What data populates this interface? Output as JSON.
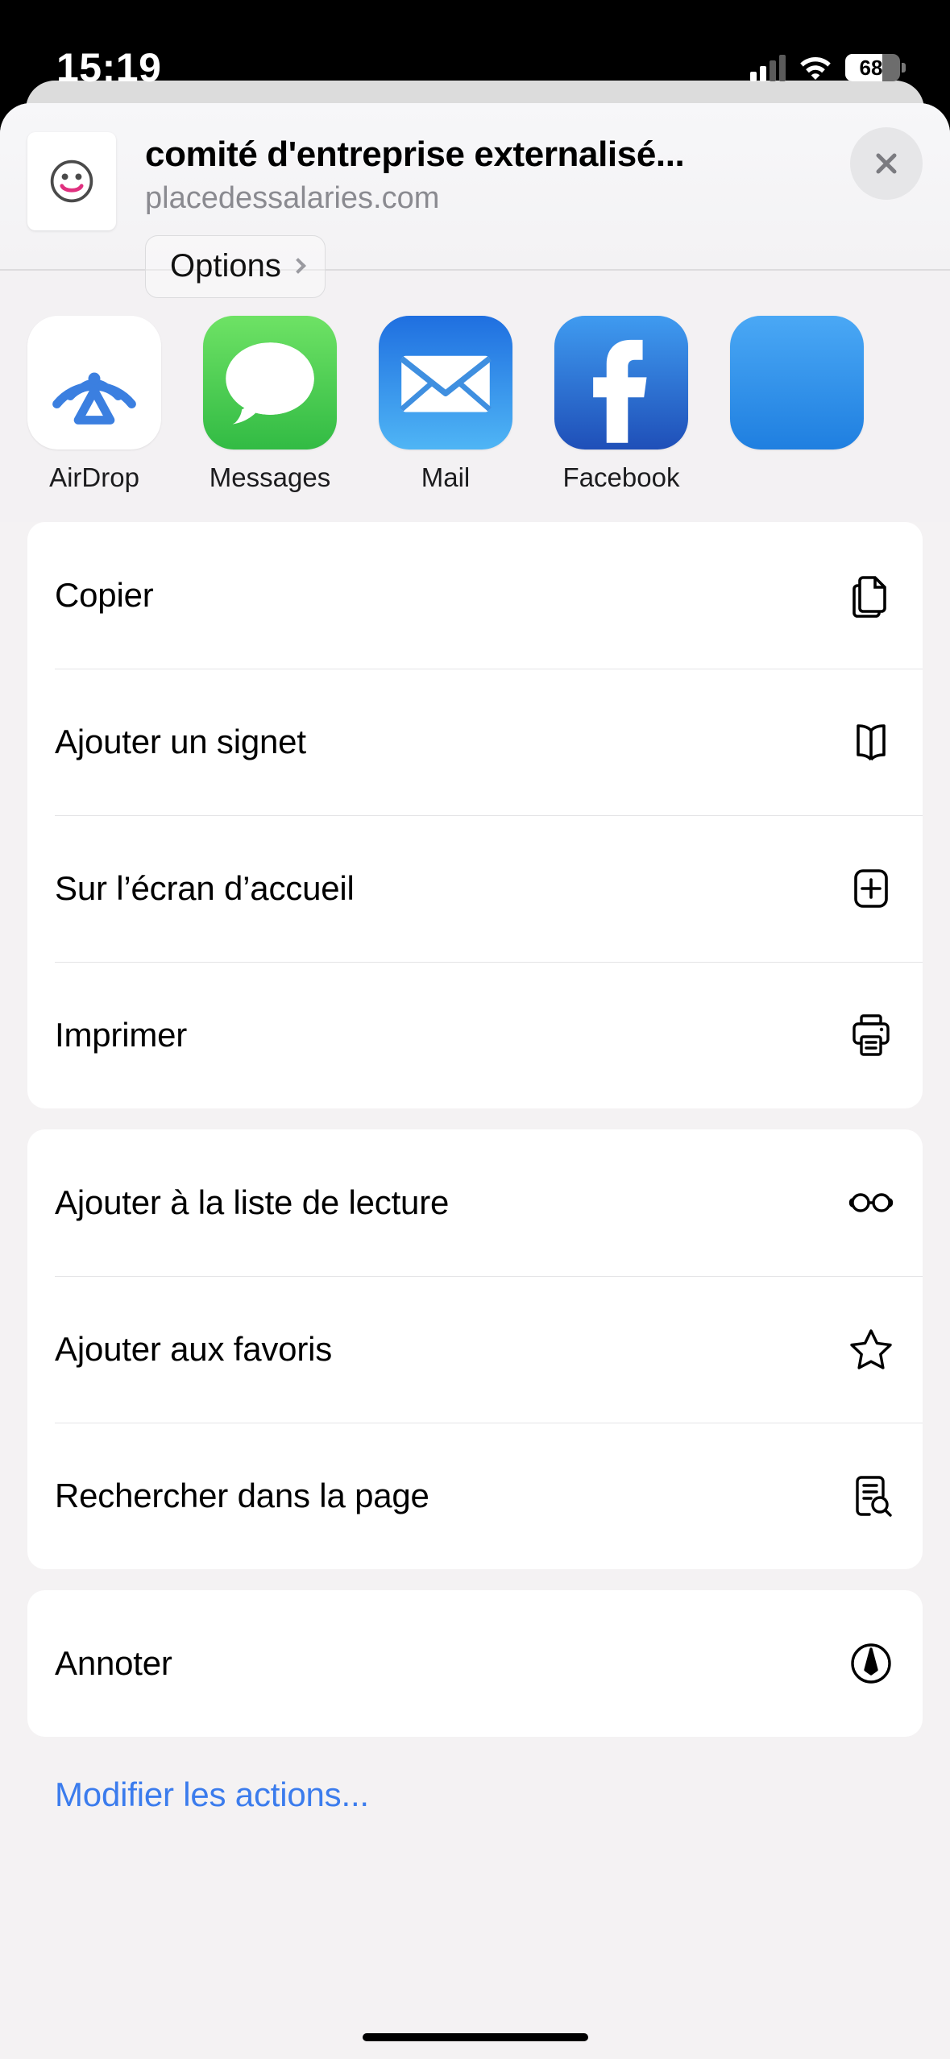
{
  "status_bar": {
    "time": "15:19",
    "battery_percent": "68",
    "battery_level": 68,
    "cellular_bars_filled": 2,
    "cellular_bars_total": 4,
    "wifi_icon": "wifi-icon",
    "battery_icon": "battery-icon"
  },
  "header": {
    "title": "comité d'entreprise externalisé...",
    "url": "placedessalaries.com",
    "options_label": "Options",
    "options_chevron_icon": "chevron-right-icon",
    "close_icon": "close-icon",
    "favicon_icon": "smiley-face-icon"
  },
  "apps": [
    {
      "label": "AirDrop",
      "icon": "airdrop-icon",
      "class": "icon-airdrop"
    },
    {
      "label": "Messages",
      "icon": "messages-icon",
      "class": "icon-messages"
    },
    {
      "label": "Mail",
      "icon": "mail-icon",
      "class": "icon-mail"
    },
    {
      "label": "Facebook",
      "icon": "facebook-icon",
      "class": "icon-facebook"
    }
  ],
  "action_groups": [
    {
      "rows": [
        {
          "label": "Copier",
          "icon": "copy-documents-icon"
        },
        {
          "label": "Ajouter un signet",
          "icon": "book-icon"
        },
        {
          "label": "Sur l’écran d’accueil",
          "icon": "add-to-home-screen-icon"
        },
        {
          "label": "Imprimer",
          "icon": "printer-icon"
        }
      ]
    },
    {
      "rows": [
        {
          "label": "Ajouter à la liste de lecture",
          "icon": "glasses-icon"
        },
        {
          "label": "Ajouter aux favoris",
          "icon": "star-icon"
        },
        {
          "label": "Rechercher dans la page",
          "icon": "find-in-page-icon"
        }
      ]
    },
    {
      "rows": [
        {
          "label": "Annoter",
          "icon": "markup-pen-icon"
        }
      ]
    }
  ],
  "edit_actions": {
    "label": "Modifier les actions..."
  },
  "colors": {
    "accent_link": "#3b7ced",
    "sheet_background": "#f4f2f3",
    "row_background": "#ffffff",
    "secondary_text": "#8a8a90"
  }
}
